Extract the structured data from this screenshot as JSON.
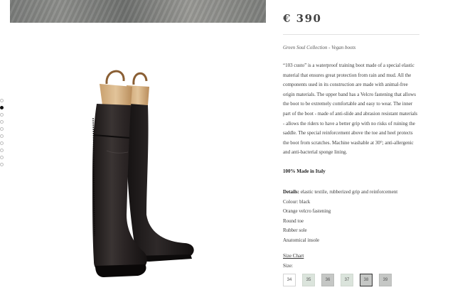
{
  "product": {
    "price": "€ 390",
    "collection": "Green Soul Collection - Vegan boots",
    "description": "“103 custo” is a waterproof training boot made of a special elastic material that ensures great protection from rain and mud. All the components used in its construction are made with animal-free origin materials. The upper band has a Velcro fastening that allows the boot to be extremely comfortable and easy to wear. The inner part of the boot - made of anti-slide and abrasion resistant materials - allows the riders to have a better grip with no risks of ruining the saddle. The special reinforcement above the toe and heel protects the boot from scratches. Machine washable at 30°; anti-allergenic and anti-bacterial sponge lining.",
    "made_in": "100% Made in Italy",
    "details_label": "Details:",
    "details_text": " elastic textile, rubberized grip and reinforcement",
    "colour": "Colour: black",
    "features": [
      "Orange velcro fastening",
      "Round toe",
      "Rubber sole",
      "Anatomical insole"
    ],
    "size_chart_link": "Size Chart",
    "size_label": "Size:",
    "sizes": [
      "34",
      "35",
      "36",
      "37",
      "38",
      "39"
    ],
    "selected_size": "38"
  },
  "gallery": {
    "dot_count": 10,
    "active_dot_index": 1
  }
}
